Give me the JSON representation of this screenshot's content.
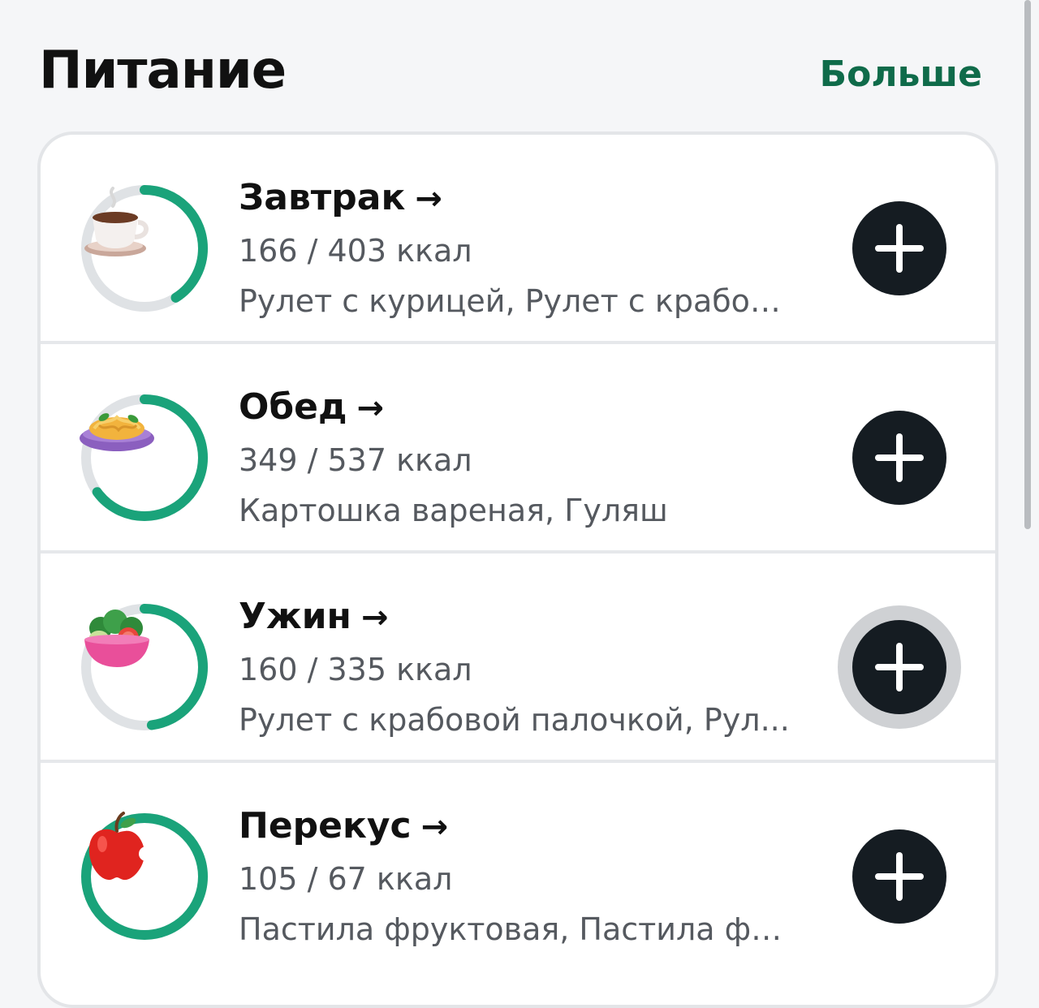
{
  "header": {
    "title": "Питание",
    "more_label": "Больше"
  },
  "colors": {
    "accent": "#1aa37a",
    "ring_track": "#dfe2e5",
    "button": "#151c22",
    "link": "#0f6b4a"
  },
  "meals": [
    {
      "name": "Завтрак",
      "arrow": "→",
      "kcal": "166 / 403 ккал",
      "foods": "Рулет с курицей, Рулет с крабов...",
      "icon": "coffee-cup-icon",
      "progress": 0.41
    },
    {
      "name": "Обед",
      "arrow": "→",
      "kcal": "349 / 537 ккал",
      "foods": "Картошка вареная, Гуляш",
      "icon": "pasta-plate-icon",
      "progress": 0.65
    },
    {
      "name": "Ужин",
      "arrow": "→",
      "kcal": "160 / 335 ккал",
      "foods": "Рулет с крабовой палочкой, Рул...",
      "icon": "salad-bowl-icon",
      "progress": 0.48
    },
    {
      "name": "Перекус",
      "arrow": "→",
      "kcal": "105 / 67 ккал",
      "foods": "Пастила фруктовая, Пастила фр...",
      "icon": "apple-icon",
      "progress": 1.0
    }
  ]
}
